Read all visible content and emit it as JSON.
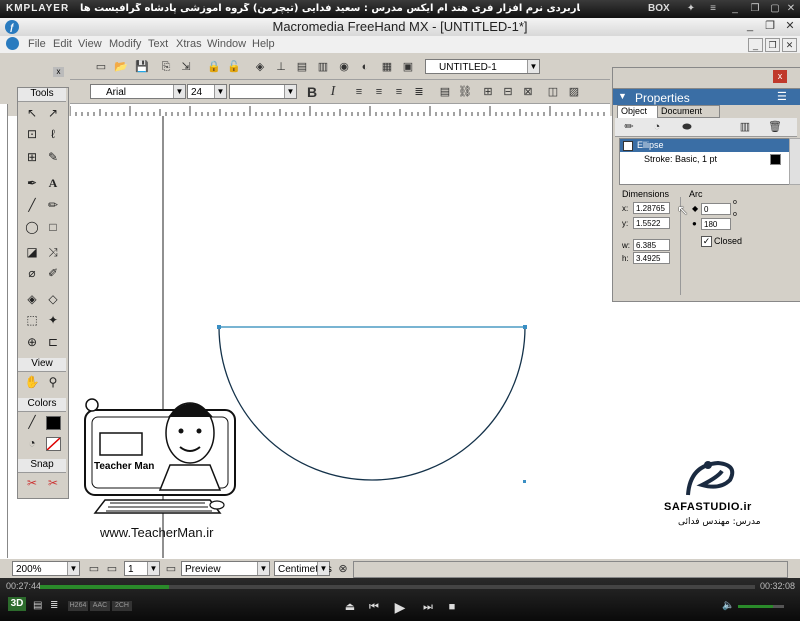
{
  "player": {
    "logo": "KMPLAYER",
    "title": "مجموعه آموزشی جامع ، گام به گام و کاربردی نرم افزار فری هند ام ایکس مدرس : سعید فدایی (تیچرمن) گروه آموزشی پادشاه گرافیست ها",
    "box_label": "BOX",
    "pin_icon": "pin-icon",
    "time_current": "00:27:44",
    "time_total": "00:32:08",
    "progress": 0.18,
    "volume": 0.75,
    "badge_3d": "3D",
    "codec_labels": [
      "H264",
      "AAC",
      "2CH"
    ]
  },
  "app": {
    "title": "Macromedia FreeHand MX - [UNTITLED-1*]",
    "menus": [
      "File",
      "Edit",
      "View",
      "Modify",
      "Text",
      "Xtras",
      "Window",
      "Help"
    ],
    "document_name": "UNTITLED-1",
    "font_name": "Arial",
    "font_size": "24",
    "bold_label": "B",
    "italic_label": "I"
  },
  "tools": {
    "header": "Tools",
    "view_header": "View",
    "colors_header": "Colors",
    "snap_header": "Snap",
    "text_tool": "A"
  },
  "properties": {
    "title": "Properties",
    "tab_object": "Object",
    "tab_document": "Document",
    "item_selected": "Ellipse",
    "item_stroke": "Stroke: Basic, 1 pt",
    "dimensions_label": "Dimensions",
    "arc_label": "Arc",
    "x_label": "x:",
    "x_value": "1.28765",
    "y_label": "y:",
    "y_value": "1.5522",
    "w_label": "w:",
    "w_value": "6.385",
    "h_label": "h:",
    "h_value": "3.4925",
    "arc_start": "0",
    "arc_end": "180",
    "closed_label": "Closed",
    "closed_checked": true
  },
  "status": {
    "zoom": "200%",
    "page": "1",
    "mode": "Preview",
    "units": "Centimeters"
  },
  "watermark": {
    "teacher_brand": "Teacher Man",
    "teacher_url": "www.TeacherMan.ir",
    "studio": "SAFASTUDIO.ir",
    "studio_instructor": "مدرس: مهندس فدائی"
  }
}
